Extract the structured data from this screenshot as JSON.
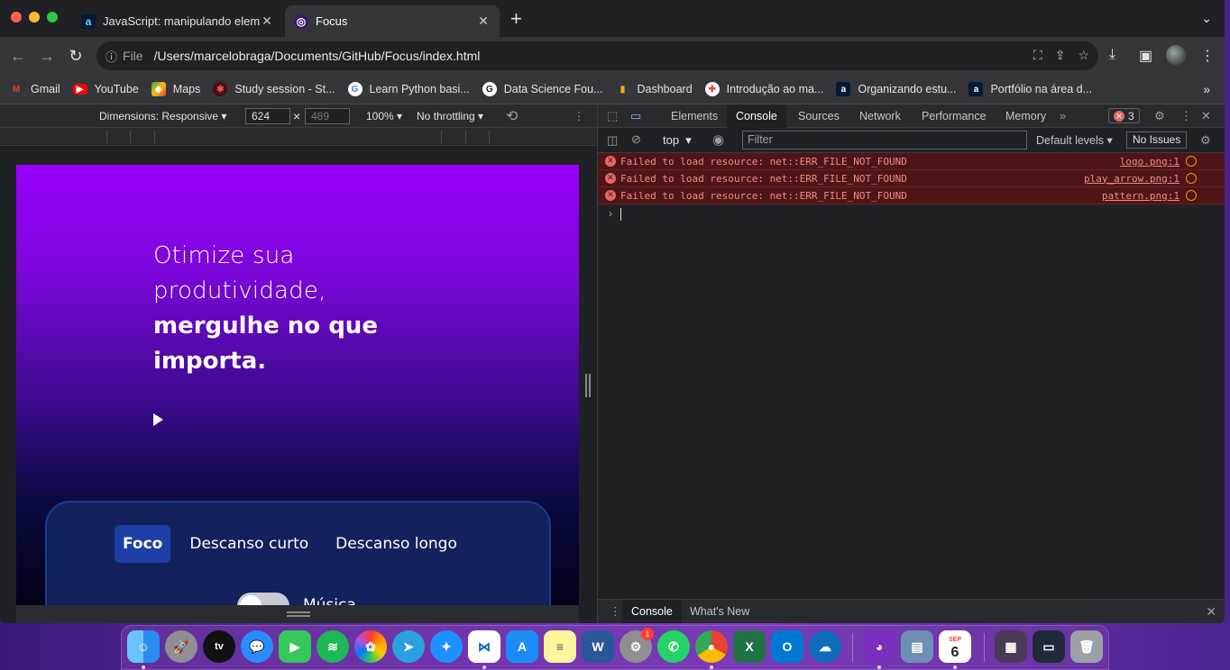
{
  "tabs": [
    {
      "title": "JavaScript: manipulando eleme",
      "icon": "alura-icon"
    },
    {
      "title": "Focus",
      "icon": "focus-icon"
    }
  ],
  "toolbar": {
    "file_label": "File",
    "url": "/Users/marcelobraga/Documents/GitHub/Focus/index.html"
  },
  "bookmarks": [
    {
      "label": "Gmail",
      "icon": "gmail-icon",
      "color": "#ea4335"
    },
    {
      "label": "YouTube",
      "icon": "youtube-icon",
      "color": "#ff0000"
    },
    {
      "label": "Maps",
      "icon": "maps-icon",
      "color": "#34a853"
    },
    {
      "label": "Study session - St...",
      "icon": "study-icon",
      "color": "#8b1a1a"
    },
    {
      "label": "Learn Python basi...",
      "icon": "google-icon",
      "color": "#4285f4"
    },
    {
      "label": "Data Science Fou...",
      "icon": "google-icon",
      "color": "#ffffff"
    },
    {
      "label": "Dashboard",
      "icon": "dashboard-icon",
      "color": "#f9ab00"
    },
    {
      "label": "Introdução ao ma...",
      "icon": "slides-icon",
      "color": "#ffffff"
    },
    {
      "label": "Organizando estu...",
      "icon": "alura-icon",
      "color": "#051933"
    },
    {
      "label": "Portfólio na área d...",
      "icon": "alura-icon",
      "color": "#051933"
    }
  ],
  "device_toolbar": {
    "dimensions": "Dimensions: Responsive",
    "width": "624",
    "times": "×",
    "height": "489",
    "zoom": "100%",
    "throttling": "No throttling"
  },
  "page": {
    "hero_line1": "Otimize sua",
    "hero_line2": "produtividade,",
    "hero_line3": "mergulhe no que",
    "hero_line4": "importa.",
    "modes": [
      "Foco",
      "Descanso curto",
      "Descanso longo"
    ],
    "music_label": "Música"
  },
  "devtools": {
    "tabs": [
      "Elements",
      "Console",
      "Sources",
      "Network",
      "Performance",
      "Memory"
    ],
    "active_tab": "Console",
    "error_count": "3",
    "context": "top",
    "filter_placeholder": "Filter",
    "levels": "Default levels",
    "issues": "No Issues",
    "logs": [
      {
        "message": "Failed to load resource: net::ERR_FILE_NOT_FOUND",
        "source": "logo.png:1"
      },
      {
        "message": "Failed to load resource: net::ERR_FILE_NOT_FOUND",
        "source": "play_arrow.png:1"
      },
      {
        "message": "Failed to load resource: net::ERR_FILE_NOT_FOUND",
        "source": "pattern.png:1"
      }
    ],
    "drawer_tabs": [
      "Console",
      "What's New"
    ]
  },
  "dock": {
    "calendar_month": "SEP",
    "calendar_day": "6",
    "notification_count": "1",
    "apple_tv": "tv"
  }
}
